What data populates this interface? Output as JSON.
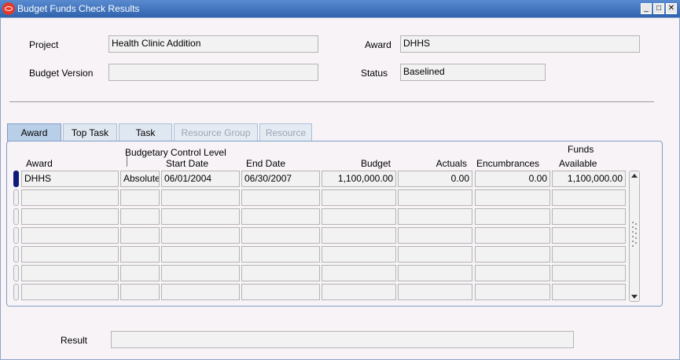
{
  "window": {
    "title": "Budget Funds Check Results"
  },
  "form": {
    "project_label": "Project",
    "project_value": "Health Clinic Addition",
    "award_label": "Award",
    "award_value": "DHHS",
    "budget_version_label": "Budget Version",
    "budget_version_value": "",
    "status_label": "Status",
    "status_value": "Baselined"
  },
  "tabs": [
    {
      "label": "Award",
      "state": "active"
    },
    {
      "label": "Top Task",
      "state": "enabled"
    },
    {
      "label": "Task",
      "state": "enabled"
    },
    {
      "label": "Resource Group",
      "state": "disabled"
    },
    {
      "label": "Resource",
      "state": "disabled"
    }
  ],
  "table": {
    "group_header": "Budgetary Control Level",
    "funds_header": "Funds",
    "columns": [
      "Award",
      "Start Date",
      "End Date",
      "Budget",
      "Actuals",
      "Encumbrances",
      "Available"
    ],
    "rows": [
      {
        "award": "DHHS",
        "level": "Absolute",
        "start": "06/01/2004",
        "end": "06/30/2007",
        "budget": "1,100,000.00",
        "actuals": "0.00",
        "encumbrances": "0.00",
        "available": "1,100,000.00"
      },
      {
        "award": "",
        "level": "",
        "start": "",
        "end": "",
        "budget": "",
        "actuals": "",
        "encumbrances": "",
        "available": ""
      },
      {
        "award": "",
        "level": "",
        "start": "",
        "end": "",
        "budget": "",
        "actuals": "",
        "encumbrances": "",
        "available": ""
      },
      {
        "award": "",
        "level": "",
        "start": "",
        "end": "",
        "budget": "",
        "actuals": "",
        "encumbrances": "",
        "available": ""
      },
      {
        "award": "",
        "level": "",
        "start": "",
        "end": "",
        "budget": "",
        "actuals": "",
        "encumbrances": "",
        "available": ""
      },
      {
        "award": "",
        "level": "",
        "start": "",
        "end": "",
        "budget": "",
        "actuals": "",
        "encumbrances": "",
        "available": ""
      },
      {
        "award": "",
        "level": "",
        "start": "",
        "end": "",
        "budget": "",
        "actuals": "",
        "encumbrances": "",
        "available": ""
      }
    ]
  },
  "result": {
    "label": "Result",
    "value": ""
  },
  "colors": {
    "titlebar": "#3b6fb6",
    "tab_active": "#b9cfe8",
    "current_row_marker": "#101a7a"
  }
}
